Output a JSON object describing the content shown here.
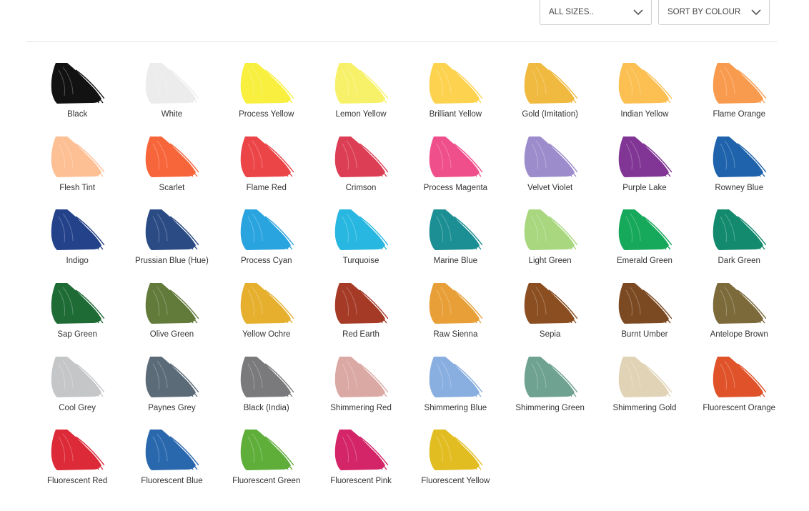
{
  "filters": {
    "sizes_label": "ALL SIZES..",
    "sort_label": "SORT BY COLOUR"
  },
  "swatches": [
    {
      "name": "Black",
      "color": "#121212"
    },
    {
      "name": "White",
      "color": "#ececec"
    },
    {
      "name": "Process Yellow",
      "color": "#f8ef3e"
    },
    {
      "name": "Lemon Yellow",
      "color": "#f7f16a"
    },
    {
      "name": "Brilliant Yellow",
      "color": "#fcd24f"
    },
    {
      "name": "Gold (Imitation)",
      "color": "#f0b93f"
    },
    {
      "name": "Indian Yellow",
      "color": "#fbbf52"
    },
    {
      "name": "Flame Orange",
      "color": "#f99b4e"
    },
    {
      "name": "Flesh Tint",
      "color": "#fdbf94"
    },
    {
      "name": "Scarlet",
      "color": "#f7663b"
    },
    {
      "name": "Flame Red",
      "color": "#ec4548"
    },
    {
      "name": "Crimson",
      "color": "#dc3f55"
    },
    {
      "name": "Process Magenta",
      "color": "#ef4f8b"
    },
    {
      "name": "Velvet Violet",
      "color": "#9c8ccc"
    },
    {
      "name": "Purple Lake",
      "color": "#813595"
    },
    {
      "name": "Rowney Blue",
      "color": "#1e63ab"
    },
    {
      "name": "Indigo",
      "color": "#23428a"
    },
    {
      "name": "Prussian Blue (Hue)",
      "color": "#2b4b85"
    },
    {
      "name": "Process Cyan",
      "color": "#2aa4df"
    },
    {
      "name": "Turquoise",
      "color": "#28b7e0"
    },
    {
      "name": "Marine Blue",
      "color": "#1b8f93"
    },
    {
      "name": "Light Green",
      "color": "#a8d77f"
    },
    {
      "name": "Emerald Green",
      "color": "#16a85b"
    },
    {
      "name": "Dark Green",
      "color": "#138a6d"
    },
    {
      "name": "Sap Green",
      "color": "#1f6b36"
    },
    {
      "name": "Olive Green",
      "color": "#627a3a"
    },
    {
      "name": "Yellow Ochre",
      "color": "#e6b02e"
    },
    {
      "name": "Red Earth",
      "color": "#a53a26"
    },
    {
      "name": "Raw Sienna",
      "color": "#e89f38"
    },
    {
      "name": "Sepia",
      "color": "#8a4e20"
    },
    {
      "name": "Burnt Umber",
      "color": "#7c4a22"
    },
    {
      "name": "Antelope Brown",
      "color": "#7c6a3a"
    },
    {
      "name": "Cool Grey",
      "color": "#c5c6c8"
    },
    {
      "name": "Paynes Grey",
      "color": "#5c6b78"
    },
    {
      "name": "Black (India)",
      "color": "#7a7a7d"
    },
    {
      "name": "Shimmering Red",
      "color": "#dba9a4"
    },
    {
      "name": "Shimmering Blue",
      "color": "#89aee0"
    },
    {
      "name": "Shimmering Green",
      "color": "#6fa291"
    },
    {
      "name": "Shimmering Gold",
      "color": "#e1d3b5"
    },
    {
      "name": "Fluorescent Orange",
      "color": "#e0532a"
    },
    {
      "name": "Fluorescent Red",
      "color": "#dc2a38"
    },
    {
      "name": "Fluorescent Blue",
      "color": "#2a68ae"
    },
    {
      "name": "Fluorescent Green",
      "color": "#5fae3a"
    },
    {
      "name": "Fluorescent Pink",
      "color": "#d32567"
    },
    {
      "name": "Fluorescent Yellow",
      "color": "#e2bd22"
    }
  ]
}
